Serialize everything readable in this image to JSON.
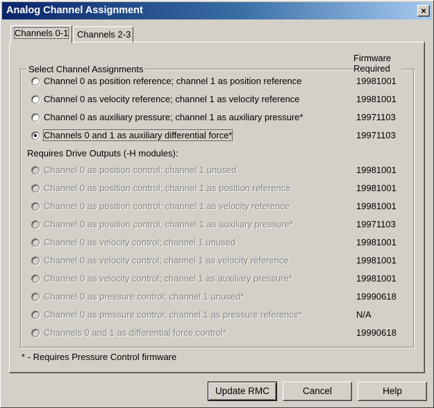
{
  "window": {
    "title": "Analog Channel Assignment",
    "close_label": "×"
  },
  "tabs": [
    {
      "label": "Channels 0-1",
      "active": true
    },
    {
      "label": "Channels 2-3",
      "active": false
    }
  ],
  "group": {
    "label": "Select Channel Assignments",
    "firmware_header": [
      "Firmware",
      "Required"
    ]
  },
  "options": [
    {
      "label": "Channel 0 as position reference; channel 1 as position reference",
      "firmware": "19981001",
      "enabled": true,
      "selected": false
    },
    {
      "label": "Channel 0 as velocity reference; channel 1 as velocity reference",
      "firmware": "19981001",
      "enabled": true,
      "selected": false
    },
    {
      "label": "Channel 0 as auxiliary pressure; channel 1 as auxiliary pressure*",
      "firmware": "19971103",
      "enabled": true,
      "selected": false
    },
    {
      "label": "Channels 0 and 1 as auxiliary differential force*",
      "firmware": "19971103",
      "enabled": true,
      "selected": true
    }
  ],
  "drive_section": {
    "label": "Requires Drive Outputs (-H modules):"
  },
  "drive_options": [
    {
      "label": "Channel 0 as position control; channel 1 unused",
      "firmware": "19981001",
      "enabled": false
    },
    {
      "label": "Channel 0 as position control; channel 1 as position reference",
      "firmware": "19981001",
      "enabled": false
    },
    {
      "label": "Channel 0 as position control; channel 1 as velocity reference",
      "firmware": "19981001",
      "enabled": false
    },
    {
      "label": "Channel 0 as position control; channel 1 as auxiliary pressure*",
      "firmware": "19971103",
      "enabled": false
    },
    {
      "label": "Channel 0 as velocity control; channel 1 unused",
      "firmware": "19981001",
      "enabled": false
    },
    {
      "label": "Channel 0 as velocity control; channel 1 as velocity reference",
      "firmware": "19981001",
      "enabled": false
    },
    {
      "label": "Channel 0 as velocity control; channel 1 as auxiliary pressure*",
      "firmware": "19981001",
      "enabled": false
    },
    {
      "label": "Channel 0 as pressure control; channel 1 unused*",
      "firmware": "19990618",
      "enabled": false
    },
    {
      "label": "Channel 0 as pressure control; channel 1 as pressure reference*",
      "firmware": "N/A",
      "enabled": false
    },
    {
      "label": "Channels 0 and 1 as differential force control*",
      "firmware": "19990618",
      "enabled": false
    }
  ],
  "footnote": "* - Requires Pressure Control firmware",
  "buttons": {
    "update": "Update RMC",
    "cancel": "Cancel",
    "help": "Help"
  }
}
